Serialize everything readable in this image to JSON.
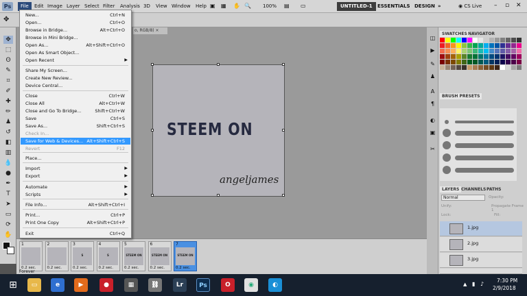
{
  "app": {
    "logo": "Ps"
  },
  "menubar": {
    "items": [
      "File",
      "Edit",
      "Image",
      "Layer",
      "Select",
      "Filter",
      "Analysis",
      "3D",
      "View",
      "Window",
      "Help"
    ],
    "zoom": "100%",
    "workspaces": [
      "UNTITLED-1",
      "ESSENTIALS",
      "DESIGN"
    ],
    "more": "»",
    "cslive": "CS Live"
  },
  "document": {
    "tab_title": "o, RGB/8)",
    "close": "×",
    "title_text": "STEEM ON",
    "signature": "angeljames"
  },
  "file_menu": {
    "items": [
      {
        "label": "New...",
        "shortcut": "Ctrl+N"
      },
      {
        "label": "Open...",
        "shortcut": "Ctrl+O"
      },
      {
        "label": "Browse in Bridge...",
        "shortcut": "Alt+Ctrl+O"
      },
      {
        "label": "Browse in Mini Bridge...",
        "shortcut": ""
      },
      {
        "label": "Open As...",
        "shortcut": "Alt+Shift+Ctrl+O"
      },
      {
        "label": "Open As Smart Object...",
        "shortcut": ""
      },
      {
        "label": "Open Recent",
        "shortcut": "",
        "submenu": true
      },
      {
        "label": "Share My Screen...",
        "shortcut": ""
      },
      {
        "label": "Create New Review...",
        "shortcut": ""
      },
      {
        "label": "Device Central...",
        "shortcut": ""
      },
      {
        "label": "Close",
        "shortcut": "Ctrl+W"
      },
      {
        "label": "Close All",
        "shortcut": "Alt+Ctrl+W"
      },
      {
        "label": "Close and Go To Bridge...",
        "shortcut": "Shift+Ctrl+W"
      },
      {
        "label": "Save",
        "shortcut": "Ctrl+S"
      },
      {
        "label": "Save As...",
        "shortcut": "Shift+Ctrl+S"
      },
      {
        "label": "Check In...",
        "shortcut": "",
        "disabled": true
      },
      {
        "label": "Save for Web & Devices...",
        "shortcut": "Alt+Shift+Ctrl+S",
        "highlighted": true
      },
      {
        "label": "Revert",
        "shortcut": "F12",
        "disabled": true
      },
      {
        "label": "Place...",
        "shortcut": ""
      },
      {
        "label": "Import",
        "shortcut": "",
        "submenu": true
      },
      {
        "label": "Export",
        "shortcut": "",
        "submenu": true
      },
      {
        "label": "Automate",
        "shortcut": "",
        "submenu": true
      },
      {
        "label": "Scripts",
        "shortcut": "",
        "submenu": true
      },
      {
        "label": "File Info...",
        "shortcut": "Alt+Shift+Ctrl+I"
      },
      {
        "label": "Print...",
        "shortcut": "Ctrl+P"
      },
      {
        "label": "Print One Copy",
        "shortcut": "Alt+Shift+Ctrl+P"
      },
      {
        "label": "Exit",
        "shortcut": "Ctrl+Q"
      }
    ]
  },
  "timeline": {
    "frames": [
      {
        "num": "1",
        "dur": "0.2 sec.",
        "thumb": ""
      },
      {
        "num": "2",
        "dur": "0.2 sec.",
        "thumb": ""
      },
      {
        "num": "3",
        "dur": "0.2 sec.",
        "thumb": "S"
      },
      {
        "num": "4",
        "dur": "0.2 sec.",
        "thumb": "S"
      },
      {
        "num": "5",
        "dur": "0.2 sec.",
        "thumb": "STEEM ON"
      },
      {
        "num": "6",
        "dur": "0.2 sec.",
        "thumb": "STEEM ON"
      },
      {
        "num": "7",
        "dur": "0.2 sec.",
        "thumb": "STEEM ON"
      }
    ],
    "loop": "Forever"
  },
  "panels": {
    "swatches_tabs": [
      "SWATCHES",
      "NAVIGATOR"
    ],
    "brush_tabs": [
      "BRUSH PRESETS"
    ],
    "layers_tabs": [
      "LAYERS",
      "CHANNELS",
      "PATHS"
    ],
    "blend_mode": "Normal",
    "opacity_label": "Opacity:",
    "unify_label": "Unify:",
    "propagate_label": "Propagate Frame 1",
    "lock_label": "Lock:",
    "fill_label": "Fill:",
    "layers": [
      "1.jpg",
      "2.jpg",
      "3.jpg"
    ]
  },
  "taskbar": {
    "time": "7:30 PM",
    "date": "2/9/2018",
    "apps": [
      "Lr",
      "Ps"
    ]
  },
  "colors": {
    "accent": "#3399ff",
    "menubar": "#d6d6d6",
    "canvas_bg": "#9a9a9a",
    "doc": "#b5b4ba",
    "taskbar": "#16202e"
  }
}
